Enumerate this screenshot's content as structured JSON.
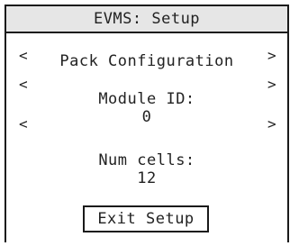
{
  "window": {
    "title": "EVMS: Setup"
  },
  "setup": {
    "menu": {
      "title": "Pack Configuration",
      "prev_glyph": "<",
      "next_glyph": ">"
    },
    "module_id": {
      "label": "Module ID:",
      "value": "0",
      "prev_glyph": "<",
      "next_glyph": ">"
    },
    "extra_arrows": {
      "prev_glyph": "<",
      "next_glyph": ">"
    },
    "num_cells": {
      "label": "Num cells:",
      "value": "12"
    },
    "exit_label": "Exit Setup"
  }
}
